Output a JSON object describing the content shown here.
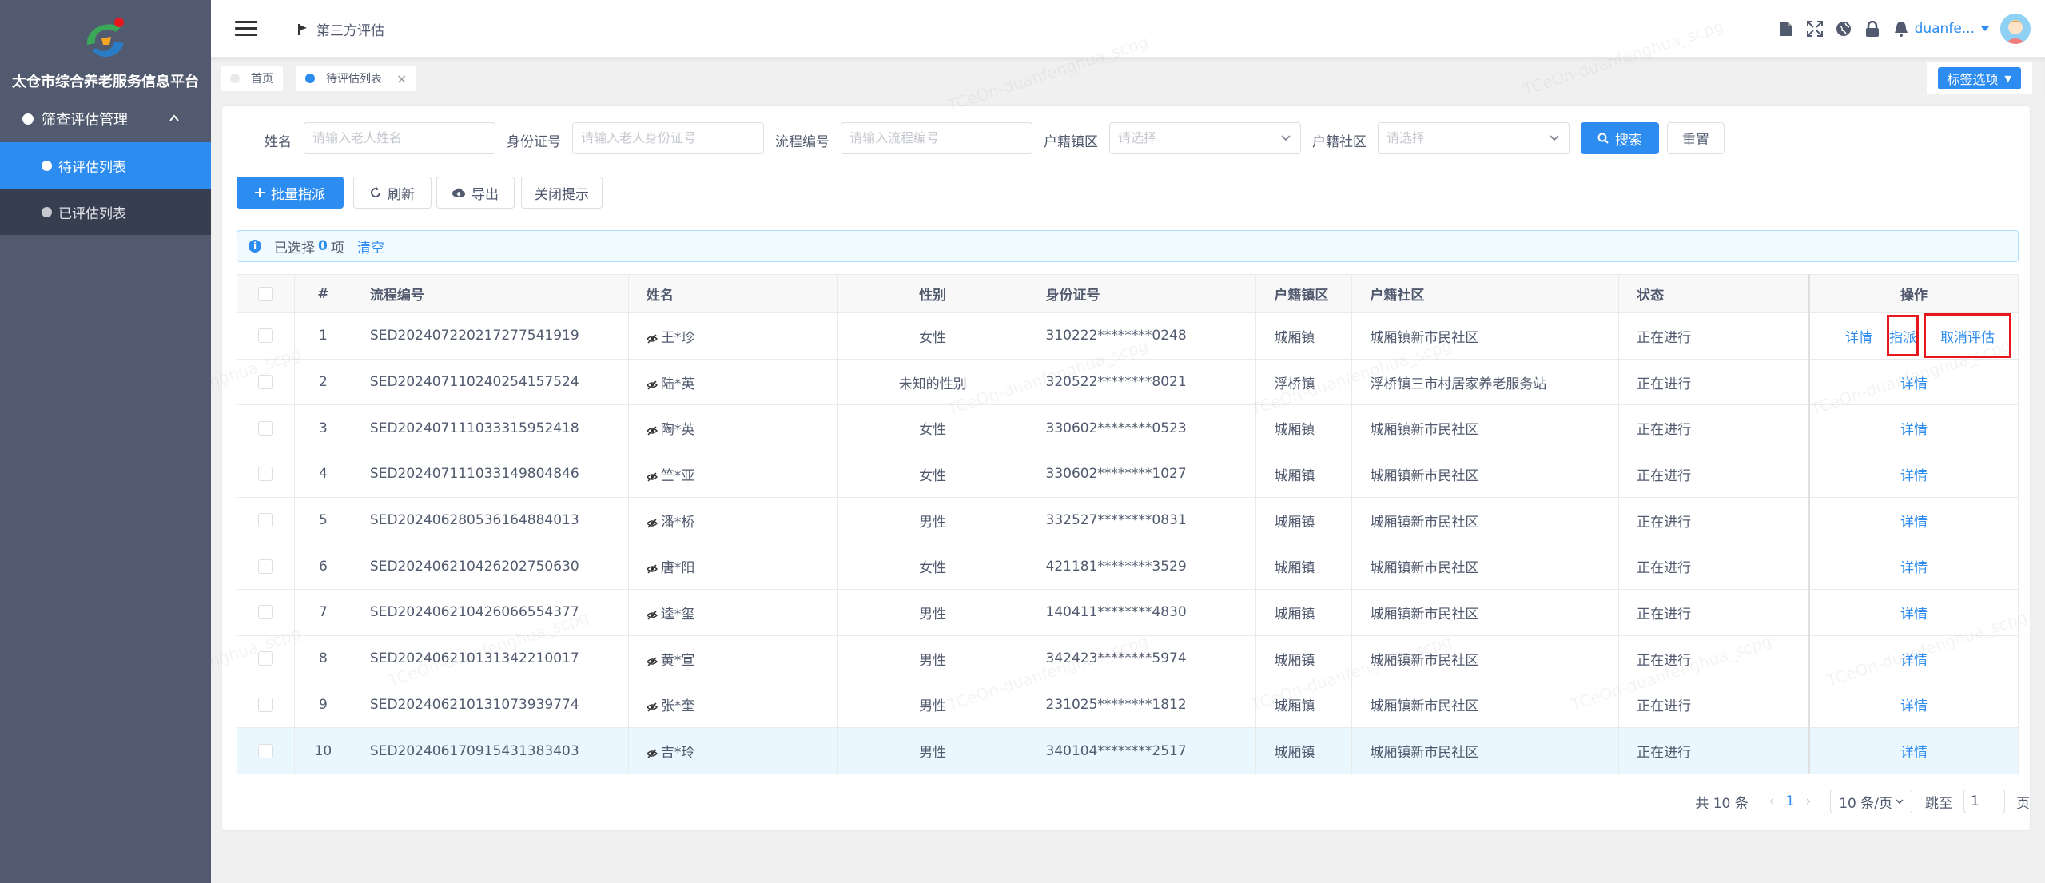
{
  "app": {
    "platform_title": "太仓市综合养老服务信息平台",
    "breadcrumb": "第三方评估"
  },
  "sidebar": {
    "group_label": "筛查评估管理",
    "items": [
      {
        "label": "待评估列表",
        "active": true
      },
      {
        "label": "已评估列表",
        "active": false
      }
    ]
  },
  "header": {
    "username": "duanfe...",
    "icons": [
      "document-icon",
      "fullscreen-icon",
      "globe-icon",
      "lock-icon",
      "bell-icon"
    ]
  },
  "tags": {
    "items": [
      {
        "label": "首页",
        "active": false
      },
      {
        "label": "待评估列表",
        "active": true,
        "closable": "×"
      }
    ],
    "options_label": "标签选项"
  },
  "search": {
    "fields": [
      {
        "label": "姓名",
        "placeholder": "请输入老人姓名"
      },
      {
        "label": "身份证号",
        "placeholder": "请输入老人身份证号"
      },
      {
        "label": "流程编号",
        "placeholder": "请输入流程编号"
      },
      {
        "label": "户籍镇区",
        "placeholder": "请选择"
      },
      {
        "label": "户籍社区",
        "placeholder": "请选择"
      }
    ],
    "search_label": "搜索",
    "reset_label": "重置"
  },
  "toolbar": {
    "batch_assign": "批量指派",
    "refresh": "刷新",
    "export": "导出",
    "close_tip": "关闭提示"
  },
  "selection": {
    "prefix": "已选择",
    "count": "0",
    "suffix": "项",
    "clear": "清空"
  },
  "table": {
    "headers": [
      "#",
      "流程编号",
      "姓名",
      "性别",
      "身份证号",
      "户籍镇区",
      "户籍社区",
      "状态",
      "操作"
    ],
    "rows": [
      {
        "no": "1",
        "flow": "SED20240722021727754191​9",
        "name": "王*珍",
        "gender": "女性",
        "id": "310222********0248",
        "town": "城厢镇",
        "community": "城厢镇新市民社区",
        "status": "正在进行"
      },
      {
        "no": "2",
        "flow": "SED20240711024025415752​4",
        "name": "陆*英",
        "gender": "未知的性别",
        "id": "320522********8021",
        "town": "浮桥镇",
        "community": "浮桥镇三市村居家养老服务站",
        "status": "正在进行"
      },
      {
        "no": "3",
        "flow": "SED20240711103331595241​8",
        "name": "陶*英",
        "gender": "女性",
        "id": "330602********0523",
        "town": "城厢镇",
        "community": "城厢镇新市民社区",
        "status": "正在进行"
      },
      {
        "no": "4",
        "flow": "SED20240711103314980484​6",
        "name": "竺*亚",
        "gender": "女性",
        "id": "330602********1027",
        "town": "城厢镇",
        "community": "城厢镇新市民社区",
        "status": "正在进行"
      },
      {
        "no": "5",
        "flow": "SED20240628053616488401​3",
        "name": "潘*桥",
        "gender": "男性",
        "id": "332527********0831",
        "town": "城厢镇",
        "community": "城厢镇新市民社区",
        "status": "正在进行"
      },
      {
        "no": "6",
        "flow": "SED20240621042620275063​0",
        "name": "唐*阳",
        "gender": "女性",
        "id": "421181********3529",
        "town": "城厢镇",
        "community": "城厢镇新市民社区",
        "status": "正在进行"
      },
      {
        "no": "7",
        "flow": "SED20240621042606655437​7",
        "name": "逵*玺",
        "gender": "男性",
        "id": "140411********4830",
        "town": "城厢镇",
        "community": "城厢镇新市民社区",
        "status": "正在进行"
      },
      {
        "no": "8",
        "flow": "SED20240621013134221001​7",
        "name": "黄*宣",
        "gender": "男性",
        "id": "342423********5974",
        "town": "城厢镇",
        "community": "城厢镇新市民社区",
        "status": "正在进行"
      },
      {
        "no": "9",
        "flow": "SED20240621013107393977​4",
        "name": "张*奎",
        "gender": "男性",
        "id": "231025********1812",
        "town": "城厢镇",
        "community": "城厢镇新市民社区",
        "status": "正在进行"
      },
      {
        "no": "10",
        "flow": "SED20240617091543138340​3",
        "name": "吉*玲",
        "gender": "男性",
        "id": "340104********2517",
        "town": "城厢镇",
        "community": "城厢镇新市民社区",
        "status": "正在进行"
      }
    ],
    "op_detail": "详情",
    "op_assign": "指派",
    "op_cancel": "取消评估"
  },
  "pagination": {
    "total": "共 10 条",
    "prev": "‹",
    "current": "1",
    "next": "›",
    "page_size": "10 条/页",
    "jump_label": "跳至",
    "jump_value": "1",
    "page_suffix": "页"
  },
  "watermark": "TCeOn-duanfenghua_scpg",
  "colors": {
    "primary": "#2d8cf0",
    "sidebar_bg": "#515a6e",
    "highlight_red": "#e8161d"
  }
}
